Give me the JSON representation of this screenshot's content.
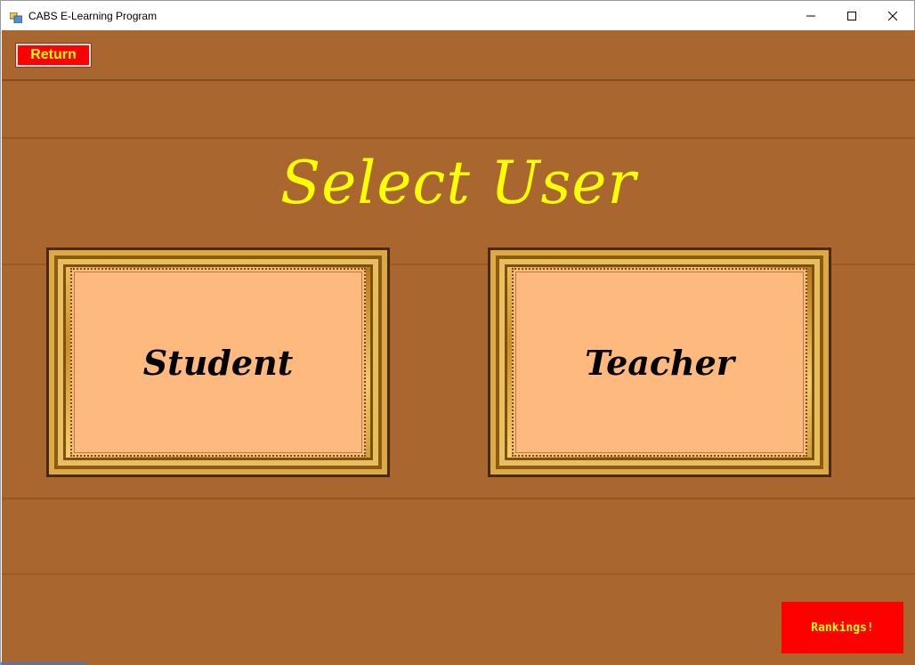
{
  "window": {
    "title": "CABS E-Learning Program",
    "controls": [
      "minimize-icon",
      "maximize-icon",
      "close-icon"
    ]
  },
  "header": {
    "return_label": "Return",
    "heading": "Select User"
  },
  "options": [
    {
      "label": "Student"
    },
    {
      "label": "Teacher"
    }
  ],
  "footer": {
    "rankings_label": "Rankings!"
  },
  "colors": {
    "accent_text": "#ffff00",
    "button_bg": "#ff0000",
    "panel_fill": "#fdb97e",
    "wood": "#a9672f"
  }
}
